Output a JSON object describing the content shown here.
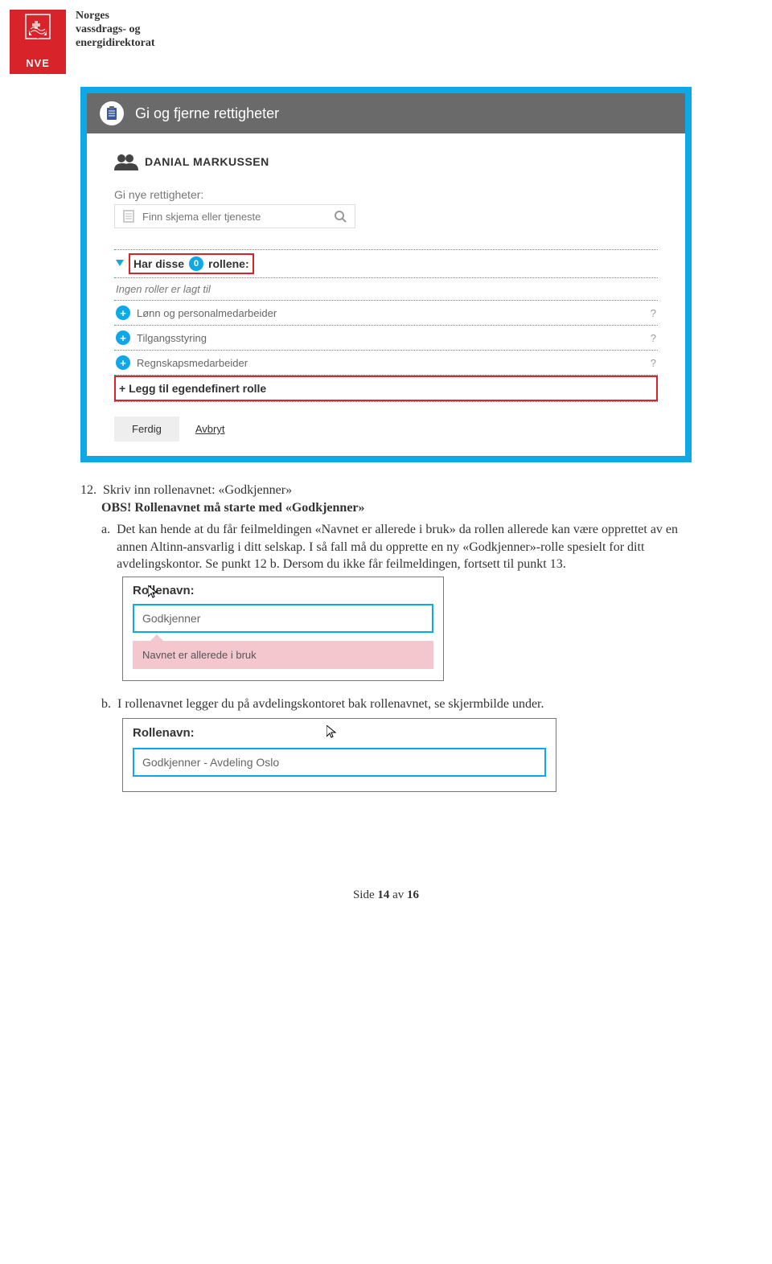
{
  "header": {
    "logo_label": "NVE",
    "org_line1": "Norges",
    "org_line2": "vassdrags- og",
    "org_line3": "energidirektorat"
  },
  "screenshot1": {
    "title": "Gi og fjerne rettigheter",
    "user": "DANIAL MARKUSSEN",
    "give_rights_label": "Gi nye rettigheter:",
    "search_placeholder": "Finn skjema eller tjeneste",
    "has_roles_prefix": "Har disse",
    "has_roles_count": "0",
    "has_roles_suffix": "rollene:",
    "no_roles": "Ingen roller er lagt til",
    "roles": [
      "Lønn og personalmedarbeider",
      "Tilgangsstyring",
      "Regnskapsmedarbeider"
    ],
    "add_custom": "+ Legg til egendefinert rolle",
    "done_btn": "Ferdig",
    "cancel_btn": "Avbryt"
  },
  "doc": {
    "item_num": "12.",
    "item_text": "Skriv inn rollenavnet: «Godkjenner»",
    "obs": "OBS! Rollenavnet må starte med «Godkjenner»",
    "a_label": "a.",
    "a_text": "Det kan hende at du får feilmeldingen «Navnet er allerede i bruk» da rollen allerede kan være opprettet av en annen Altinn-ansvarlig i ditt selskap. I så fall må du opprette en ny «Godkjenner»-rolle spesielt for ditt avdelingskontor. Se punkt 12 b. Dersom du ikke får feilmeldingen, fortsett til punkt 13.",
    "b_label": "b.",
    "b_text": "I rollenavnet legger du på avdelingskontoret bak rollenavnet, se skjermbilde under."
  },
  "screenshot2": {
    "label": "Rollenavn:",
    "value": "Godkjenner",
    "error": "Navnet er allerede i bruk"
  },
  "screenshot3": {
    "label": "Rollenavn:",
    "value": "Godkjenner - Avdeling Oslo"
  },
  "footer": {
    "prefix": "Side ",
    "page": "14",
    "mid": " av ",
    "total": "16"
  }
}
